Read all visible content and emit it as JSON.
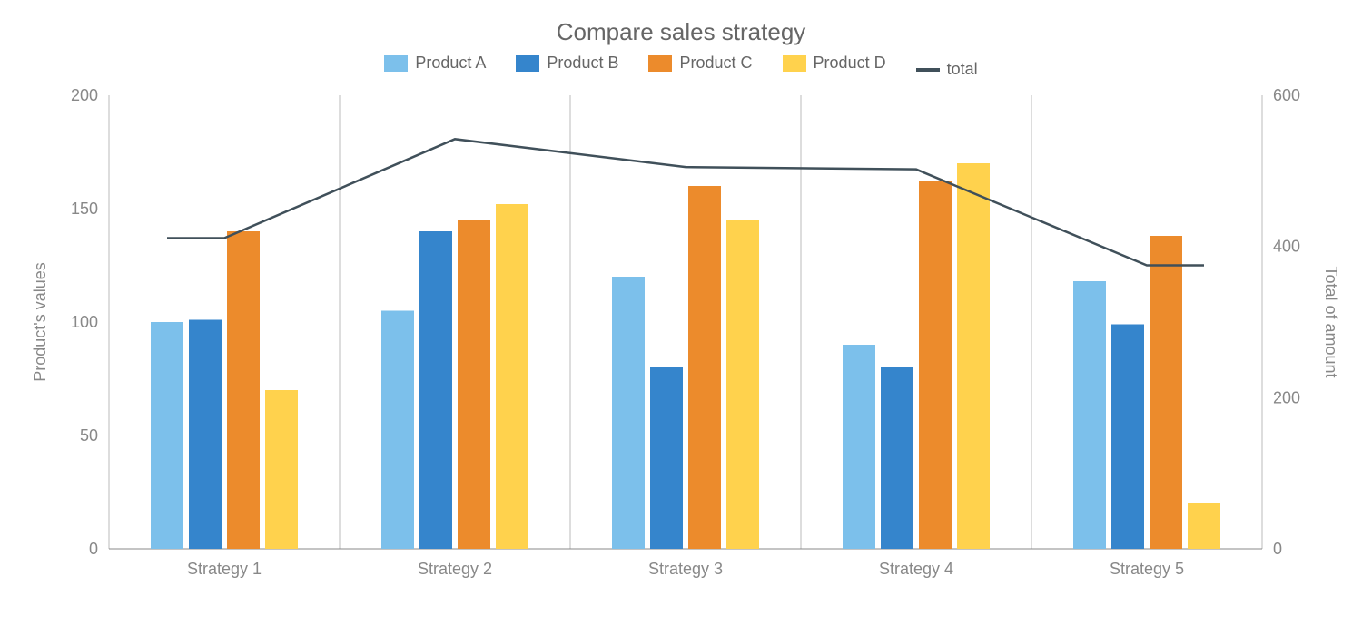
{
  "chart_data": {
    "type": "bar",
    "title": "Compare sales strategy",
    "categories": [
      "Strategy 1",
      "Strategy 2",
      "Strategy 3",
      "Strategy 4",
      "Strategy 5"
    ],
    "series": [
      {
        "name": "Product A",
        "values": [
          100,
          105,
          120,
          90,
          118
        ],
        "color": "#7cc0eb"
      },
      {
        "name": "Product B",
        "values": [
          101,
          140,
          80,
          80,
          99
        ],
        "color": "#3585cc"
      },
      {
        "name": "Product C",
        "values": [
          140,
          145,
          160,
          162,
          138
        ],
        "color": "#ec8b2c"
      },
      {
        "name": "Product D",
        "values": [
          70,
          152,
          145,
          170,
          20
        ],
        "color": "#ffd24d"
      }
    ],
    "line_series": {
      "name": "total",
      "values": [
        411,
        542,
        505,
        502,
        375
      ],
      "color": "#40505a"
    },
    "ylabel": "Product's values",
    "y2label": "Total of amount",
    "ylim": [
      0,
      200
    ],
    "y2lim": [
      0,
      600
    ],
    "yticks": [
      0,
      50,
      100,
      150,
      200
    ],
    "y2ticks": [
      0,
      200,
      400,
      600
    ]
  },
  "legend_labels": {
    "a": "Product A",
    "b": "Product B",
    "c": "Product C",
    "d": "Product D",
    "total": "total"
  }
}
